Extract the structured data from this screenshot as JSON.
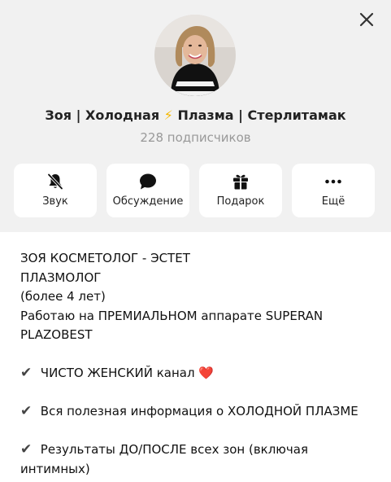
{
  "channel": {
    "title_part1": "Зоя | Холодная",
    "title_emoji": "⚡",
    "title_part2": "Плазма | Стерлитамак",
    "subscribers": "228 подписчиков"
  },
  "actions": [
    {
      "label": "Звук",
      "icon": "bell-off-icon"
    },
    {
      "label": "Обсуждение",
      "icon": "chat-bubble-icon"
    },
    {
      "label": "Подарок",
      "icon": "gift-icon"
    },
    {
      "label": "Ещё",
      "icon": "more-dots-icon"
    }
  ],
  "description": {
    "lines": [
      "ЗОЯ КОСМЕТОЛОГ - ЭСТЕТ",
      "ПЛАЗМОЛОГ",
      "(более 4 лет)",
      "Работаю на ПРЕМИАЛЬНОМ аппарате SUPERAN",
      "PLAZOBEST"
    ],
    "check_symbol": "✔",
    "bullet1": "ЧИСТО ЖЕНСКИЙ канал",
    "heart": "❤️",
    "bullet2": "Вся полезная информация о ХОЛОДНОЙ ПЛАЗМЕ",
    "bullet3_line1": "Результаты ДО/ПОСЛЕ всех зон (включая",
    "bullet3_line2": "интимных)"
  },
  "colors": {
    "header_bg": "#f1f1f1",
    "bolt": "#f5b800",
    "heart": "#e0242c",
    "muted_text": "#999999"
  }
}
